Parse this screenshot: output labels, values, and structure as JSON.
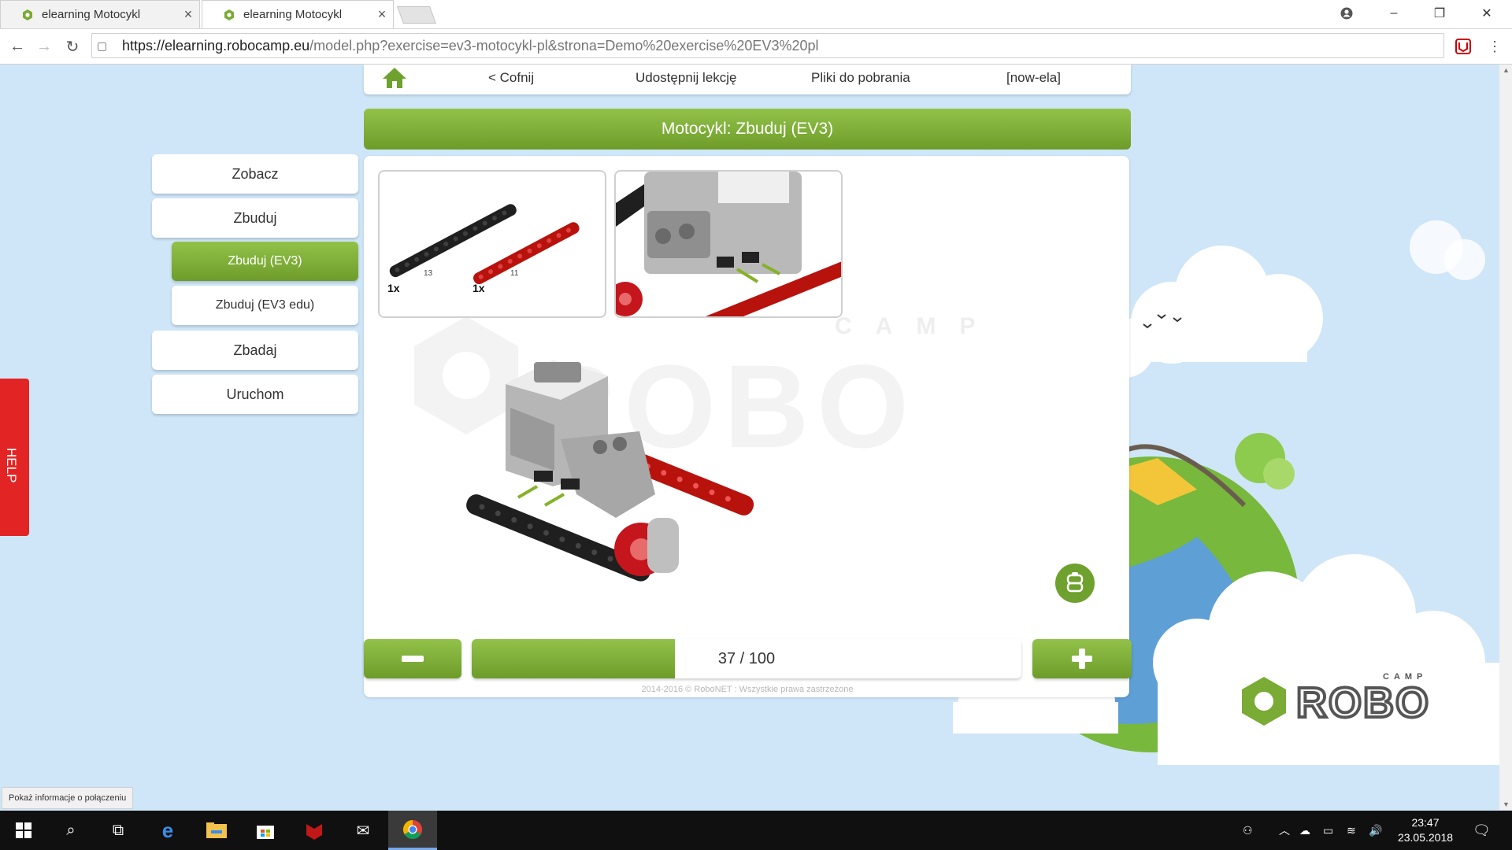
{
  "browser": {
    "tabs": [
      {
        "title": "elearning Motocykl",
        "active": false
      },
      {
        "title": "elearning Motocykl",
        "active": true
      }
    ],
    "url_host": "https://elearning.robocamp.eu",
    "url_path": "/model.php?exercise=ev3-motocykl-pl&strona=Demo%20exercise%20EV3%20pl"
  },
  "nav": {
    "back": "< Cofnij",
    "share": "Udostępnij lekcję",
    "downloads": "Pliki do pobrania",
    "user": "[now-ela]"
  },
  "banner_title": "Motocykl: Zbuduj (EV3)",
  "sidebar": [
    {
      "label": "Zobacz"
    },
    {
      "label": "Zbuduj"
    },
    {
      "label": "Zbuduj (EV3)",
      "active": true
    },
    {
      "label": "Zbuduj (EV3 edu)"
    },
    {
      "label": "Zbadaj"
    },
    {
      "label": "Uruchom"
    }
  ],
  "parts": [
    {
      "qty": "1x",
      "length": "13",
      "color": "black"
    },
    {
      "qty": "1x",
      "length": "11",
      "color": "red"
    }
  ],
  "watermark": {
    "robo": "ROBO",
    "camp": "CAMP"
  },
  "progress": {
    "text": "37 / 100",
    "current": 37,
    "total": 100
  },
  "footer": "2014-2016 © RoboNET : Wszystkie prawa zastrzeżone",
  "help_label": "HELP",
  "status_text": "Pokaż informacje o połączeniu",
  "logo": {
    "robo": "ROBO",
    "camp": "CAMP"
  },
  "clock": {
    "time": "23:47",
    "date": "23.05.2018"
  },
  "colors": {
    "accent_green": "#7aab35",
    "help_red": "#e32424",
    "sky": "#cfe6f8"
  }
}
